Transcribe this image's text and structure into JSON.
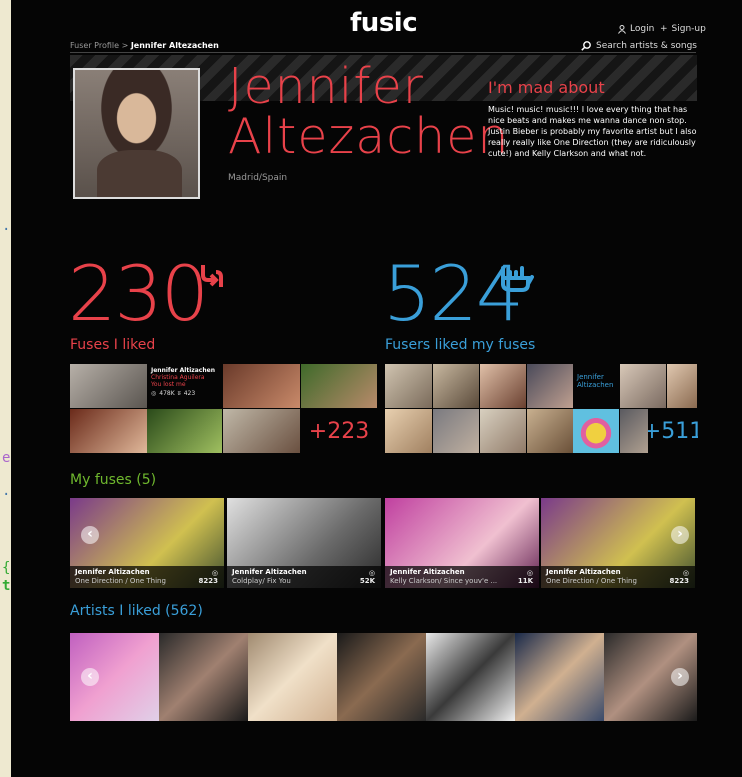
{
  "header": {
    "logo": "fusic",
    "login": "Login",
    "signup": "Sign-up",
    "search_label": "Search artists & songs"
  },
  "breadcrumb": {
    "parent": "Fuser Profile",
    "separator": ">",
    "current": "Jennifer Altezachen"
  },
  "profile": {
    "first_name": "Jennifer",
    "last_name": "Altezachen",
    "location": "Madrid/Spain",
    "mad_heading": "I'm mad about",
    "mad_text": "Music! music! music!!! I love every thing that has nice beats and makes me wanna dance non stop. Justin Bieber is probably my favorite artist but I also really really like One Direction (they are ridiculously cute!) and Kelly Clarkson and what not."
  },
  "stats": {
    "liked_count": "230",
    "liked_label": "Fuses I liked",
    "likers_count": "524",
    "likers_label": "Fusers liked my fuses"
  },
  "featured_fuse": {
    "user": "Jennifer Altizachen",
    "artist": "Christina Aguilera",
    "song": "You lost me",
    "plays": "478K",
    "likes": "423"
  },
  "liked_more": "+223",
  "liker_name_line1": "Jennifer",
  "liker_name_line2": "Altizachen",
  "likers_more": "+511",
  "my_fuses": {
    "title": "My fuses (5)",
    "items": [
      {
        "user": "Jennifer Altizachen",
        "track": "One Direction / One Thing",
        "count": "8223"
      },
      {
        "user": "Jennifer Altizachen",
        "track": "Coldplay/ Fix You",
        "count": "52K"
      },
      {
        "user": "Jennifer Altizachen",
        "track": "Kelly Clarkson/ Since youv'e ...",
        "count": "11K"
      },
      {
        "user": "Jennifer Altizachen",
        "track": "One Direction / One Thing",
        "count": "8223"
      }
    ]
  },
  "artists": {
    "title": "Artists I liked (562)"
  },
  "colors": {
    "accent_red": "#e8424a",
    "accent_blue": "#3a9fd9",
    "accent_green": "#6fb82e"
  },
  "icons": [
    "user-icon",
    "plus-icon",
    "search-icon",
    "refuse-arrow-icon",
    "rock-hand-icon",
    "play-count-icon",
    "chevron-left-icon",
    "chevron-right-icon"
  ]
}
